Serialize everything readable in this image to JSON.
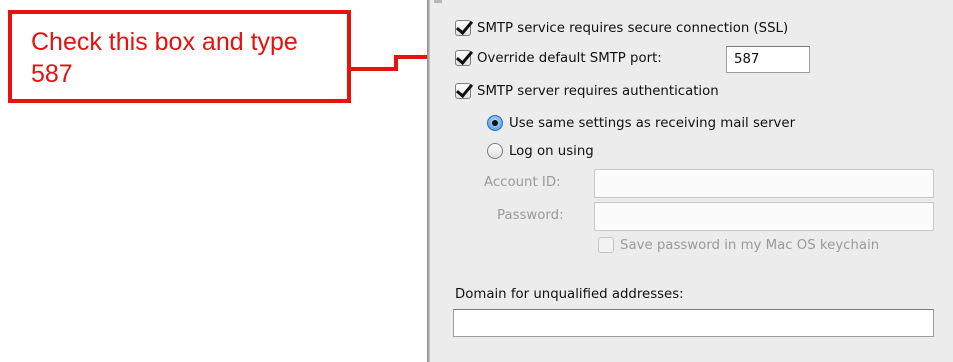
{
  "callout": {
    "text": "Check this box and type 587"
  },
  "smtp": {
    "ssl_label": "SMTP service requires secure connection (SSL)",
    "ssl_checked": true,
    "override_port_label": "Override default SMTP port:",
    "override_port_checked": true,
    "port_value": "587",
    "auth_label": "SMTP server requires authentication",
    "auth_checked": true,
    "radio_same_label": "Use same settings as receiving mail server",
    "radio_logon_label": "Log on using",
    "selected_radio": "same",
    "account_id_label": "Account ID:",
    "account_id_value": "",
    "password_label": "Password:",
    "password_value": "",
    "save_password_label": "Save password in my Mac OS keychain",
    "save_password_checked": false,
    "domain_label": "Domain for unqualified addresses:",
    "domain_value": ""
  },
  "colors": {
    "callout": "#e8110d",
    "panel_bg": "#ececec"
  }
}
